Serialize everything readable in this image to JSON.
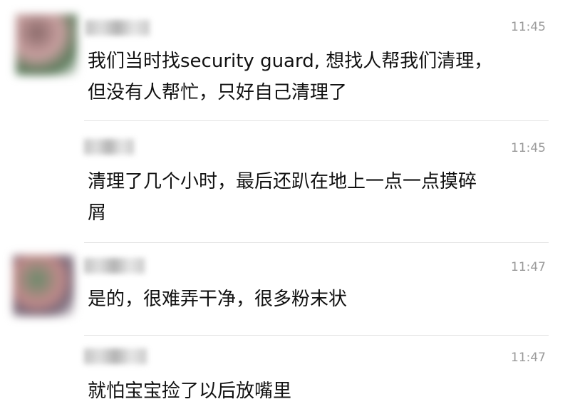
{
  "messages": [
    {
      "time": "11:45",
      "text": "我们当时找security guard, 想找人帮我们清理，\n但没有人帮忙，只好自己清理了"
    },
    {
      "time": "11:45",
      "text": "清理了几个小时，最后还趴在地上一点一点摸碎\n屑"
    },
    {
      "time": "11:47",
      "text": "是的，很难弄干净，很多粉末状"
    },
    {
      "time": "11:47",
      "text": "就怕宝宝捡了以后放嘴里"
    }
  ]
}
